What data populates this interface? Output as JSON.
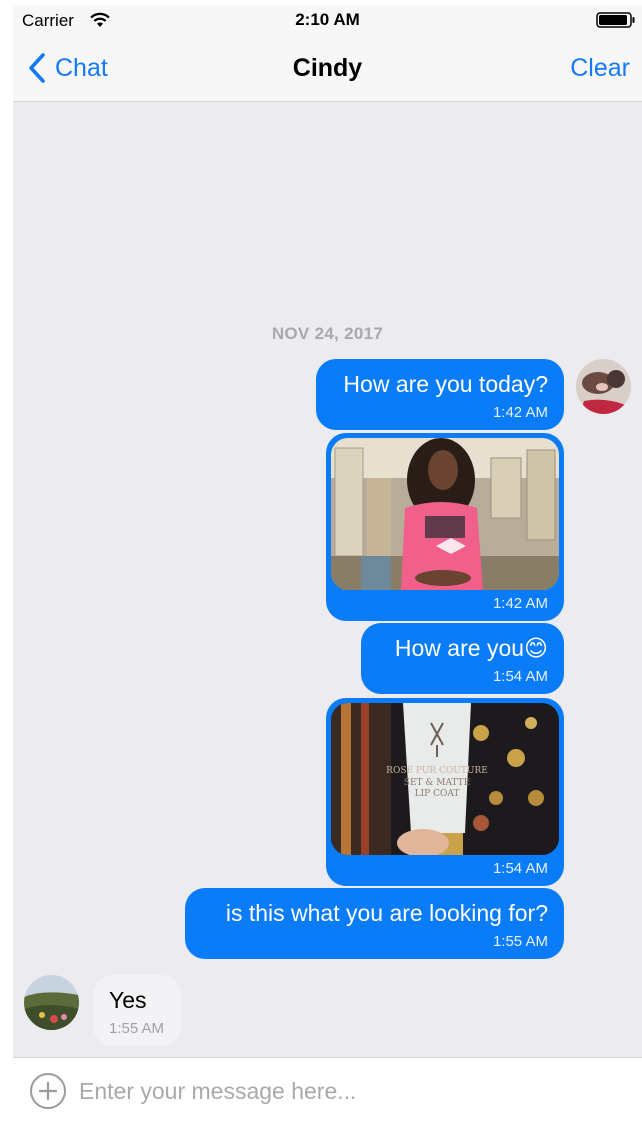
{
  "status_bar": {
    "carrier": "Carrier",
    "time": "2:10 AM"
  },
  "nav": {
    "back_label": "Chat",
    "title": "Cindy",
    "clear_label": "Clear"
  },
  "chat": {
    "date_separator": "NOV 24, 2017",
    "messages": [
      {
        "sender": "me",
        "type": "text",
        "text": "How are you today?",
        "time": "1:42 AM"
      },
      {
        "sender": "me",
        "type": "image",
        "image": "woman in pink t-shirt photo",
        "time": "1:42 AM"
      },
      {
        "sender": "me",
        "type": "text",
        "text": "How are you😊",
        "time": "1:54 AM"
      },
      {
        "sender": "me",
        "type": "image",
        "image": "lip coat tube product photo",
        "time": "1:54 AM"
      },
      {
        "sender": "me",
        "type": "text",
        "text": "is this what you are looking for?",
        "time": "1:55 AM"
      },
      {
        "sender": "Cindy",
        "type": "text",
        "text": "Yes",
        "time": "1:55 AM"
      }
    ],
    "product_label": {
      "line1": "ROSE PUR COUTURE",
      "line2": "SET & MATTE",
      "line3": "LIP COAT"
    }
  },
  "input": {
    "placeholder": "Enter your message here..."
  },
  "colors": {
    "accent": "#1479f6",
    "bubble_out": "#0a7cf7",
    "bubble_in": "#f3f3f6",
    "chat_bg": "#ebebf0"
  },
  "icons": {
    "back": "chevron-left-icon",
    "add": "plus-circle-icon",
    "wifi": "wifi-icon",
    "battery": "battery-icon"
  }
}
